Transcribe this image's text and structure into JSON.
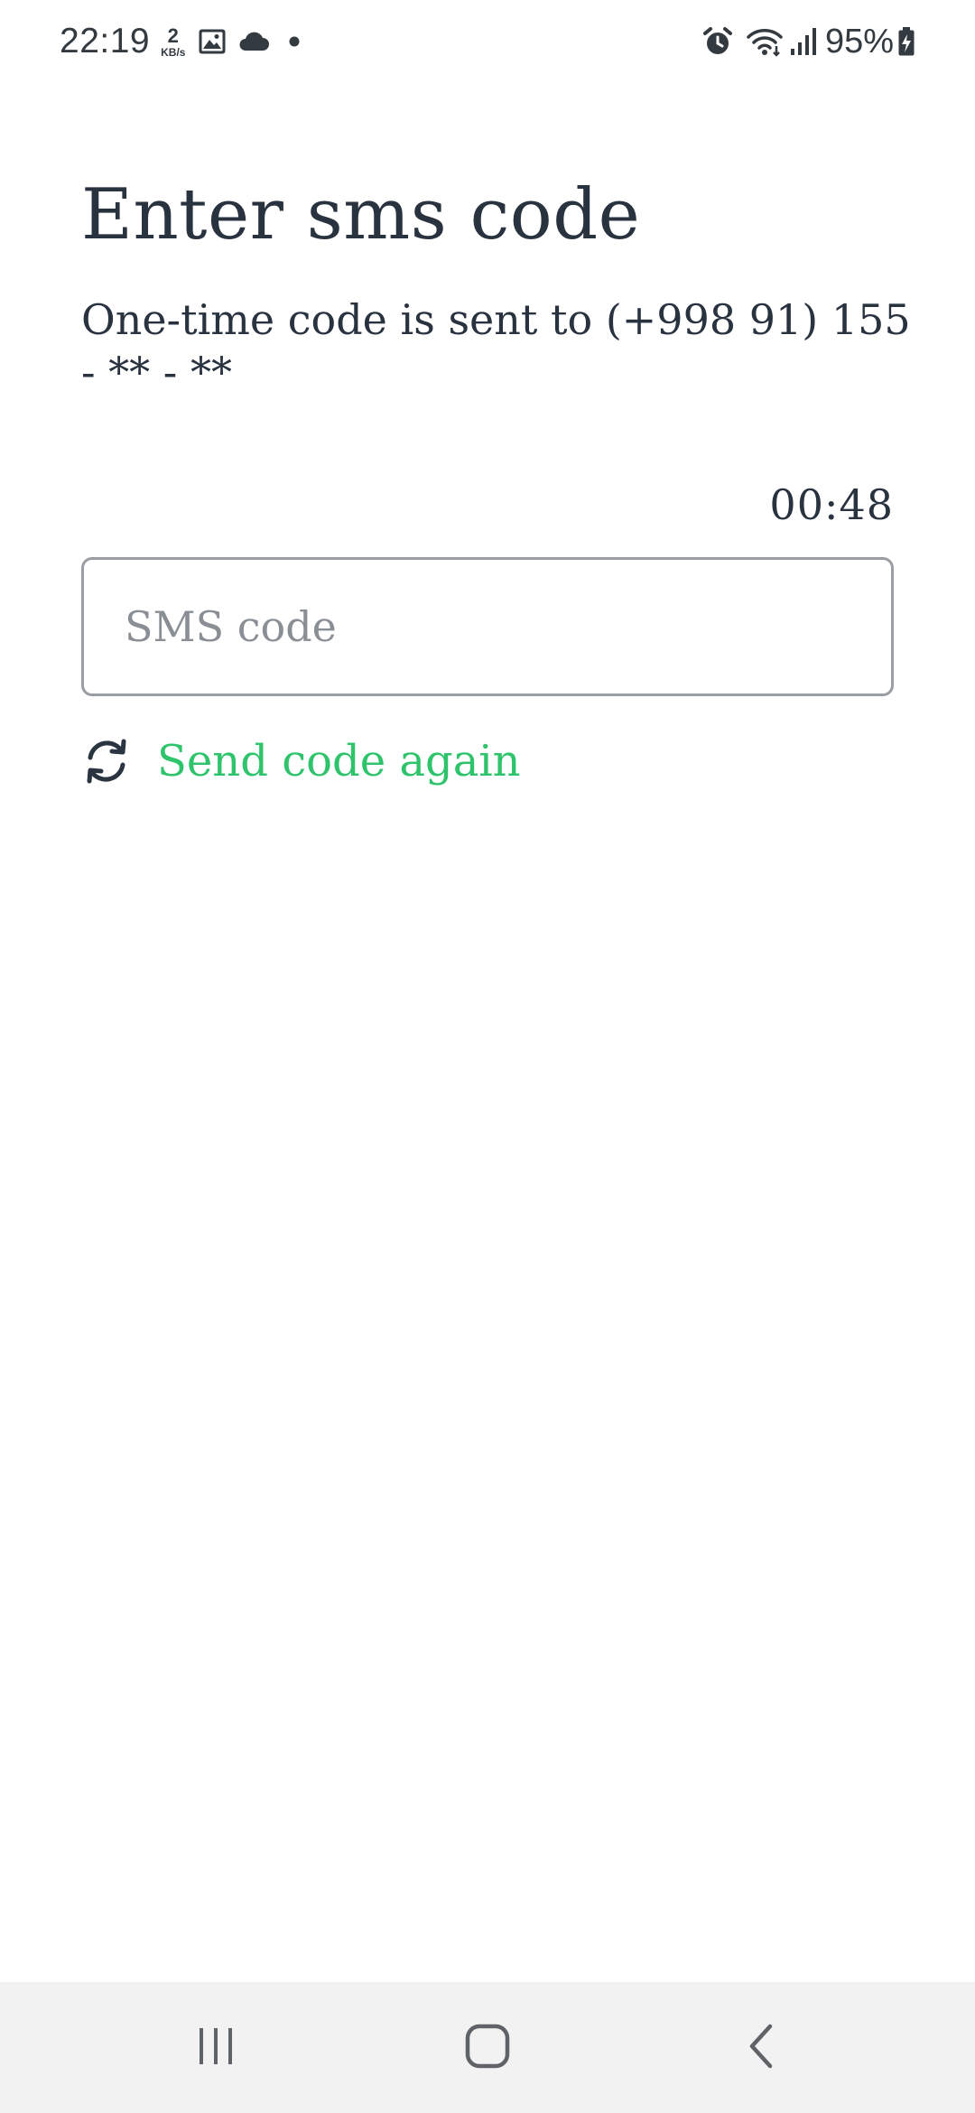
{
  "status_bar": {
    "time": "22:19",
    "net_speed_value": "2",
    "net_speed_unit": "KB/s",
    "battery_percent": "95%",
    "left_icons": [
      "gallery-icon",
      "cloud-icon",
      "notification-dot-icon"
    ],
    "right_icons": [
      "alarm-icon",
      "wifi-icon",
      "cellular-signal-icon",
      "battery-charging-icon"
    ]
  },
  "page": {
    "title": "Enter sms code",
    "subtitle": "One-time code is sent to (+998 91) 155 - ** - **",
    "timer": "00:48"
  },
  "sms_input": {
    "value": "",
    "placeholder": "SMS code"
  },
  "resend": {
    "label": "Send code again",
    "icon": "refresh-icon"
  },
  "nav_bar": {
    "buttons": [
      "recents-icon",
      "home-icon",
      "back-icon"
    ]
  },
  "colors": {
    "text": "#29323f",
    "accent_green": "#2fc46c",
    "input_border": "#9a9ea3",
    "placeholder": "#8a8f95",
    "nav_bar_bg": "#f2f2f2"
  }
}
